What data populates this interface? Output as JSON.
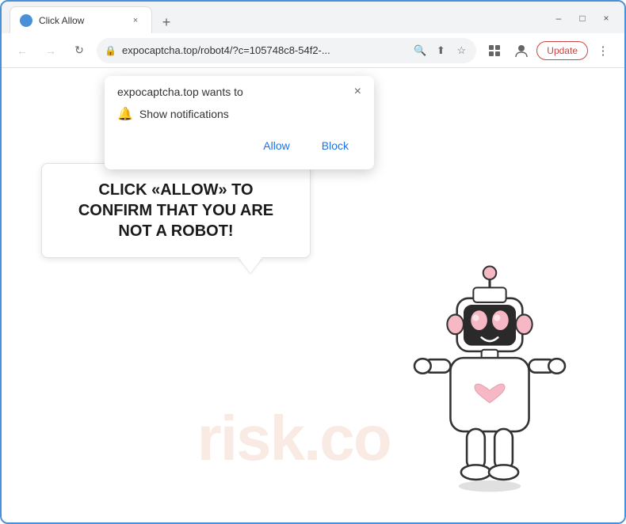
{
  "window": {
    "title": "Click Allow",
    "controls": {
      "minimize": "–",
      "maximize": "□",
      "close": "×"
    }
  },
  "tab": {
    "favicon": "●",
    "title": "Click Allow",
    "close": "×"
  },
  "new_tab_btn": "+",
  "address_bar": {
    "lock_icon": "🔒",
    "url": "expocaptcha.top/robot4/?c=105748c8-54f2-...",
    "search_icon": "🔍",
    "share_icon": "⬆",
    "star_icon": "☆",
    "extensions_icon": "⊡",
    "profile_icon": "👤",
    "update_label": "Update",
    "menu_icon": "⋮"
  },
  "nav": {
    "back": "←",
    "forward": "→",
    "refresh": "↻"
  },
  "notification_popup": {
    "title": "expocaptcha.top wants to",
    "close": "×",
    "notification_icon": "🔔",
    "notification_text": "Show notifications",
    "allow_label": "Allow",
    "block_label": "Block"
  },
  "speech_bubble": {
    "text": "CLICK «ALLOW» TO CONFIRM THAT YOU ARE NOT A ROBOT!"
  },
  "watermark": {
    "text": "risk.co"
  },
  "colors": {
    "border": "#4a90d9",
    "allow_text": "#1a73e8",
    "block_text": "#1a73e8",
    "update_border": "#c44444",
    "update_text": "#c44444"
  }
}
